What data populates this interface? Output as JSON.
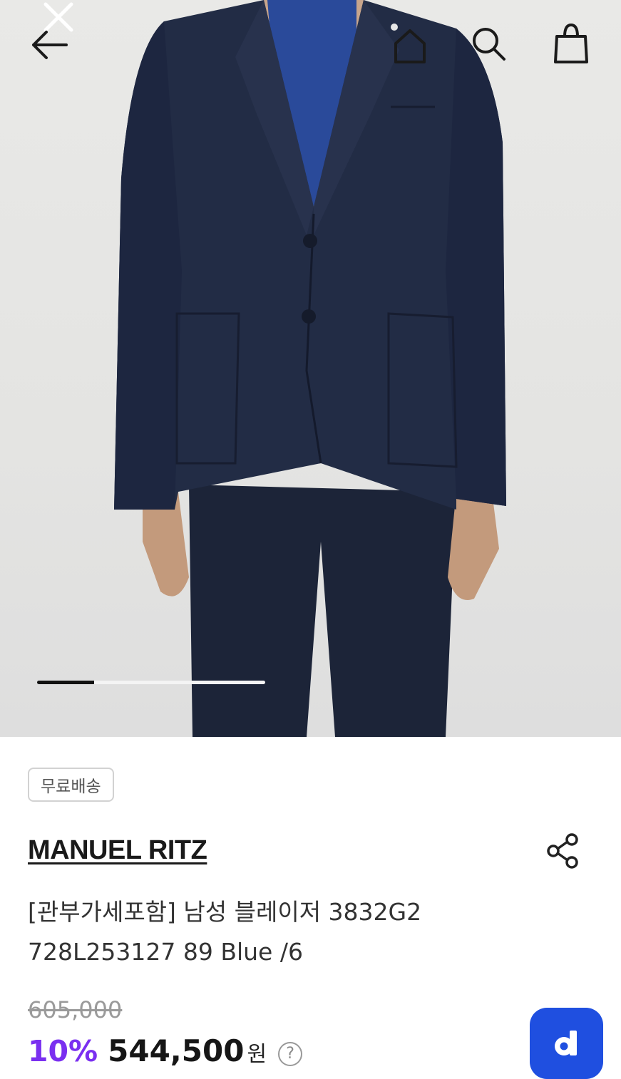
{
  "product": {
    "free_shipping_badge": "무료배송",
    "brand": "MANUEL RITZ",
    "name_line1": "[관부가세포함] 남성 블레이저 3832G2",
    "name_line2": "728L253127 89 Blue /6",
    "original_price": "605,000",
    "discount": "10%",
    "sale_price": "544,500",
    "currency": "원",
    "help_symbol": "?"
  },
  "gallery": {
    "progress_fraction": 0.25
  },
  "icons": {
    "close": "close-icon",
    "back": "back-arrow-icon",
    "home": "home-icon",
    "search": "search-icon",
    "bag": "shopping-bag-icon",
    "share": "share-icon",
    "app": "app-logo-icon"
  },
  "colors": {
    "discount": "#7a2ff0",
    "app_button": "#1f4fe0"
  }
}
